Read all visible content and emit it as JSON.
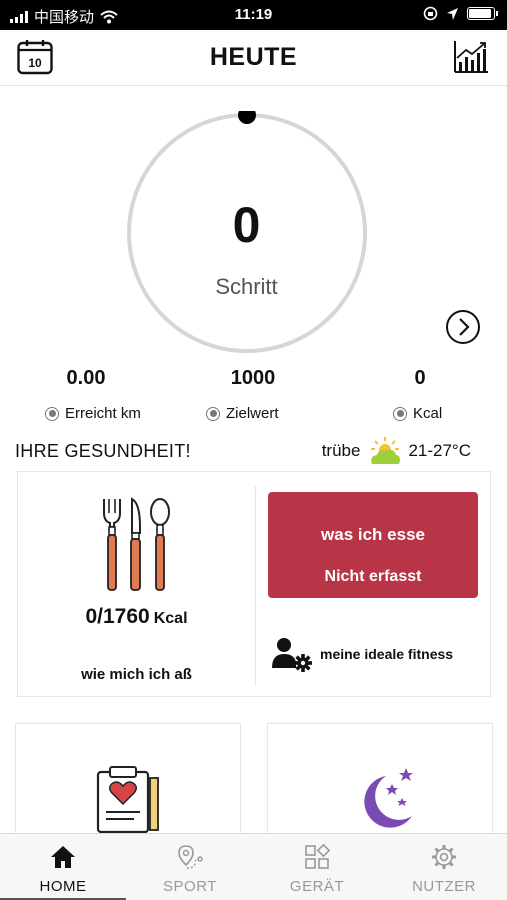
{
  "status_bar": {
    "carrier": "中国移动",
    "time": "11:19"
  },
  "header": {
    "title": "HEUTE",
    "calendar_day": "10"
  },
  "steps": {
    "value": "0",
    "label": "Schritt",
    "progress": 0
  },
  "stats": [
    {
      "value": "0.00",
      "label": "Erreicht km"
    },
    {
      "value": "1000",
      "label": "Zielwert"
    },
    {
      "value": "0",
      "label": "Kcal"
    }
  ],
  "health": {
    "title": "IHRE GESUNDHEIT!"
  },
  "weather": {
    "condition": "trübe",
    "temperature": "21-27°C"
  },
  "nutrition": {
    "kcal_value": "0/1760",
    "kcal_unit": "Kcal",
    "ate_label": "wie mich ich aß",
    "food_button_title": "was ich esse",
    "food_button_status": "Nicht erfasst",
    "fitness_label": "meine ideale fitness"
  },
  "tabs": [
    {
      "label": "HOME",
      "icon": "home-icon",
      "active": true
    },
    {
      "label": "SPORT",
      "icon": "route-icon",
      "active": false
    },
    {
      "label": "GERÄT",
      "icon": "device-icon",
      "active": false
    },
    {
      "label": "NUTZER",
      "icon": "gear-icon",
      "active": false
    }
  ],
  "colors": {
    "accent": "#b83547",
    "ring": "#d6d6d6",
    "moon": "#7b4bb4",
    "weather_icon": "#9ccf3a"
  }
}
